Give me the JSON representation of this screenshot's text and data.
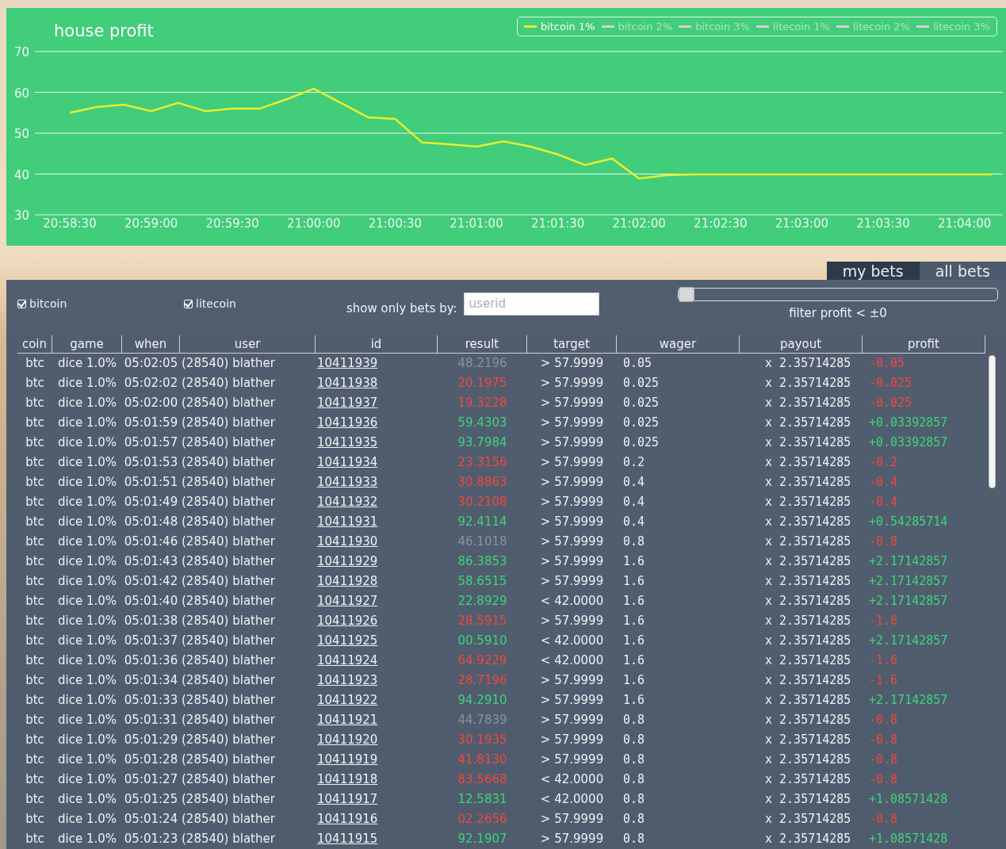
{
  "chart": {
    "other_series": [
      {
        "label": "bitcoin 2%",
        "enabled": false
      },
      {
        "label": "bitcoin 3%",
        "enabled": false
      },
      {
        "label": "litecoin 1%",
        "enabled": false
      },
      {
        "label": "litecoin 2%",
        "enabled": false
      },
      {
        "label": "litecoin 3%",
        "enabled": false
      }
    ],
    "chart_data": {
      "type": "line",
      "title": "house profit",
      "grid": true,
      "x": [
        "20:58:30",
        null,
        null,
        "20:59:00",
        null,
        null,
        "20:59:30",
        null,
        null,
        "21:00:00",
        null,
        null,
        "21:00:30",
        null,
        null,
        "21:01:00",
        null,
        null,
        "21:01:30",
        null,
        null,
        "21:02:00",
        null,
        null,
        "21:02:30",
        null,
        null,
        "21:03:00",
        null,
        null,
        "21:03:30",
        null,
        null,
        "21:04:00",
        null
      ],
      "series": [
        {
          "name": "bitcoin 1%",
          "color": "#e6ef2e",
          "values": [
            55,
            56.4,
            57,
            55.4,
            57.4,
            55.4,
            56,
            56,
            58.3,
            60.9,
            57.4,
            53.9,
            53.5,
            47.7,
            47.3,
            46.7,
            48,
            46.7,
            44.8,
            42.2,
            43.8,
            38.9,
            39.7,
            39.9,
            39.9,
            39.9,
            39.9,
            39.9,
            39.9,
            39.9,
            39.9,
            39.9,
            39.9,
            39.9,
            39.9
          ]
        }
      ],
      "ylim": [
        30,
        70
      ],
      "yticks": [
        30,
        40,
        50,
        60,
        70
      ]
    }
  },
  "tabs": [
    {
      "label": "my bets",
      "selected": false
    },
    {
      "label": "all bets",
      "selected": true
    }
  ],
  "filters": {
    "coins": [
      {
        "label": "bitcoin",
        "checked": true
      },
      {
        "label": "litecoin",
        "checked": true
      }
    ],
    "user_label": "show only bets by:",
    "user_placeholder": "userid",
    "slider": {
      "level": 0
    },
    "slider_label": "filter profit < ±0"
  },
  "table": {
    "columns": [
      "coin",
      "game",
      "when",
      "user",
      "id",
      "result",
      "target",
      "wager",
      "payout",
      "profit"
    ],
    "rows": [
      {
        "coin": "btc",
        "game": "dice 1.0%",
        "when": "05:02:05",
        "user": "(28540) blather",
        "id": "10411939",
        "result": "48.2196",
        "color": "#8a939e",
        "target": "> 57.9999",
        "wager": "0.05",
        "payout": "x 2.35714285",
        "profit": "-0.05",
        "win": false
      },
      {
        "coin": "btc",
        "game": "dice 1.0%",
        "when": "05:02:02",
        "user": "(28540) blather",
        "id": "10411938",
        "result": "20.1975",
        "color": "#f0483e",
        "target": "> 57.9999",
        "wager": "0.025",
        "payout": "x 2.35714285",
        "profit": "-0.025",
        "win": false
      },
      {
        "coin": "btc",
        "game": "dice 1.0%",
        "when": "05:02:00",
        "user": "(28540) blather",
        "id": "10411937",
        "result": "19.3228",
        "color": "#f0483e",
        "target": "> 57.9999",
        "wager": "0.025",
        "payout": "x 2.35714285",
        "profit": "-0.025",
        "win": false
      },
      {
        "coin": "btc",
        "game": "dice 1.0%",
        "when": "05:01:59",
        "user": "(28540) blather",
        "id": "10411936",
        "result": "59.4303",
        "color": "#3ed47a",
        "target": "> 57.9999",
        "wager": "0.025",
        "payout": "x 2.35714285",
        "profit": "+0.03392857",
        "win": true
      },
      {
        "coin": "btc",
        "game": "dice 1.0%",
        "when": "05:01:57",
        "user": "(28540) blather",
        "id": "10411935",
        "result": "93.7984",
        "color": "#3ed47a",
        "target": "> 57.9999",
        "wager": "0.025",
        "payout": "x 2.35714285",
        "profit": "+0.03392857",
        "win": true
      },
      {
        "coin": "btc",
        "game": "dice 1.0%",
        "when": "05:01:53",
        "user": "(28540) blather",
        "id": "10411934",
        "result": "23.3156",
        "color": "#f0483e",
        "target": "> 57.9999",
        "wager": "0.2",
        "payout": "x 2.35714285",
        "profit": "-0.2",
        "win": false
      },
      {
        "coin": "btc",
        "game": "dice 1.0%",
        "when": "05:01:51",
        "user": "(28540) blather",
        "id": "10411933",
        "result": "30.8863",
        "color": "#f0483e",
        "target": "> 57.9999",
        "wager": "0.4",
        "payout": "x 2.35714285",
        "profit": "-0.4",
        "win": false
      },
      {
        "coin": "btc",
        "game": "dice 1.0%",
        "when": "05:01:49",
        "user": "(28540) blather",
        "id": "10411932",
        "result": "30.2108",
        "color": "#f0483e",
        "target": "> 57.9999",
        "wager": "0.4",
        "payout": "x 2.35714285",
        "profit": "-0.4",
        "win": false
      },
      {
        "coin": "btc",
        "game": "dice 1.0%",
        "when": "05:01:48",
        "user": "(28540) blather",
        "id": "10411931",
        "result": "92.4114",
        "color": "#3ed47a",
        "target": "> 57.9999",
        "wager": "0.4",
        "payout": "x 2.35714285",
        "profit": "+0.54285714",
        "win": true
      },
      {
        "coin": "btc",
        "game": "dice 1.0%",
        "when": "05:01:46",
        "user": "(28540) blather",
        "id": "10411930",
        "result": "46.1018",
        "color": "#8a939e",
        "target": "> 57.9999",
        "wager": "0.8",
        "payout": "x 2.35714285",
        "profit": "-0.8",
        "win": false
      },
      {
        "coin": "btc",
        "game": "dice 1.0%",
        "when": "05:01:43",
        "user": "(28540) blather",
        "id": "10411929",
        "result": "86.3853",
        "color": "#3ed47a",
        "target": "> 57.9999",
        "wager": "1.6",
        "payout": "x 2.35714285",
        "profit": "+2.17142857",
        "win": true
      },
      {
        "coin": "btc",
        "game": "dice 1.0%",
        "when": "05:01:42",
        "user": "(28540) blather",
        "id": "10411928",
        "result": "58.6515",
        "color": "#3ed47a",
        "target": "> 57.9999",
        "wager": "1.6",
        "payout": "x 2.35714285",
        "profit": "+2.17142857",
        "win": true
      },
      {
        "coin": "btc",
        "game": "dice 1.0%",
        "when": "05:01:40",
        "user": "(28540) blather",
        "id": "10411927",
        "result": "22.8929",
        "color": "#3ed47a",
        "target": "< 42.0000",
        "wager": "1.6",
        "payout": "x 2.35714285",
        "profit": "+2.17142857",
        "win": true
      },
      {
        "coin": "btc",
        "game": "dice 1.0%",
        "when": "05:01:38",
        "user": "(28540) blather",
        "id": "10411926",
        "result": "28.5915",
        "color": "#f0483e",
        "target": "> 57.9999",
        "wager": "1.6",
        "payout": "x 2.35714285",
        "profit": "-1.6",
        "win": false
      },
      {
        "coin": "btc",
        "game": "dice 1.0%",
        "when": "05:01:37",
        "user": "(28540) blather",
        "id": "10411925",
        "result": "00.5910",
        "color": "#3ed47a",
        "target": "< 42.0000",
        "wager": "1.6",
        "payout": "x 2.35714285",
        "profit": "+2.17142857",
        "win": true
      },
      {
        "coin": "btc",
        "game": "dice 1.0%",
        "when": "05:01:36",
        "user": "(28540) blather",
        "id": "10411924",
        "result": "64.9229",
        "color": "#f0483e",
        "target": "< 42.0000",
        "wager": "1.6",
        "payout": "x 2.35714285",
        "profit": "-1.6",
        "win": false
      },
      {
        "coin": "btc",
        "game": "dice 1.0%",
        "when": "05:01:34",
        "user": "(28540) blather",
        "id": "10411923",
        "result": "28.7196",
        "color": "#f0483e",
        "target": "> 57.9999",
        "wager": "1.6",
        "payout": "x 2.35714285",
        "profit": "-1.6",
        "win": false
      },
      {
        "coin": "btc",
        "game": "dice 1.0%",
        "when": "05:01:33",
        "user": "(28540) blather",
        "id": "10411922",
        "result": "94.2910",
        "color": "#3ed47a",
        "target": "> 57.9999",
        "wager": "1.6",
        "payout": "x 2.35714285",
        "profit": "+2.17142857",
        "win": true
      },
      {
        "coin": "btc",
        "game": "dice 1.0%",
        "when": "05:01:31",
        "user": "(28540) blather",
        "id": "10411921",
        "result": "44.7839",
        "color": "#8a939e",
        "target": "> 57.9999",
        "wager": "0.8",
        "payout": "x 2.35714285",
        "profit": "-0.8",
        "win": false
      },
      {
        "coin": "btc",
        "game": "dice 1.0%",
        "when": "05:01:29",
        "user": "(28540) blather",
        "id": "10411920",
        "result": "30.1935",
        "color": "#f0483e",
        "target": "> 57.9999",
        "wager": "0.8",
        "payout": "x 2.35714285",
        "profit": "-0.8",
        "win": false
      },
      {
        "coin": "btc",
        "game": "dice 1.0%",
        "when": "05:01:28",
        "user": "(28540) blather",
        "id": "10411919",
        "result": "41.8130",
        "color": "#f0483e",
        "target": "> 57.9999",
        "wager": "0.8",
        "payout": "x 2.35714285",
        "profit": "-0.8",
        "win": false
      },
      {
        "coin": "btc",
        "game": "dice 1.0%",
        "when": "05:01:27",
        "user": "(28540) blather",
        "id": "10411918",
        "result": "83.5668",
        "color": "#f0483e",
        "target": "< 42.0000",
        "wager": "0.8",
        "payout": "x 2.35714285",
        "profit": "-0.8",
        "win": false
      },
      {
        "coin": "btc",
        "game": "dice 1.0%",
        "when": "05:01:25",
        "user": "(28540) blather",
        "id": "10411917",
        "result": "12.5831",
        "color": "#3ed47a",
        "target": "< 42.0000",
        "wager": "0.8",
        "payout": "x 2.35714285",
        "profit": "+1.08571428",
        "win": true
      },
      {
        "coin": "btc",
        "game": "dice 1.0%",
        "when": "05:01:24",
        "user": "(28540) blather",
        "id": "10411916",
        "result": "02.2656",
        "color": "#f0483e",
        "target": "> 57.9999",
        "wager": "0.8",
        "payout": "x 2.35714285",
        "profit": "-0.8",
        "win": false
      },
      {
        "coin": "btc",
        "game": "dice 1.0%",
        "when": "05:01:23",
        "user": "(28540) blather",
        "id": "10411915",
        "result": "92.1907",
        "color": "#3ed47a",
        "target": "> 57.9999",
        "wager": "0.8",
        "payout": "x 2.35714285",
        "profit": "+1.08571428",
        "win": true
      }
    ]
  }
}
